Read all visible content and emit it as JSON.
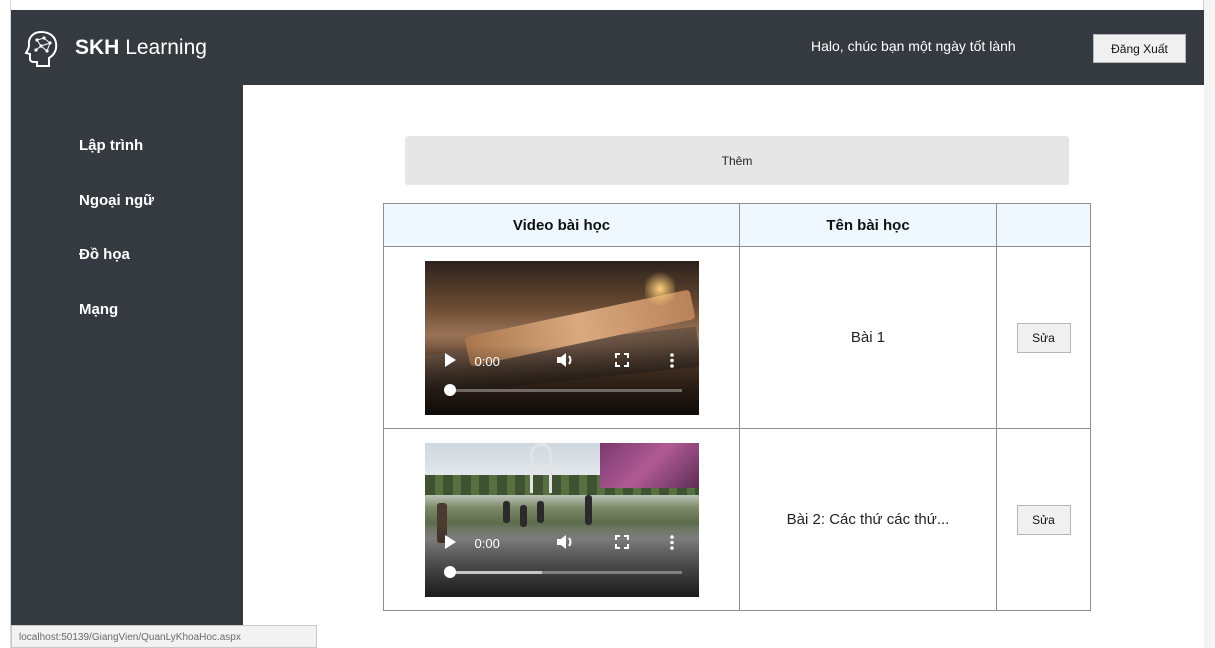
{
  "header": {
    "brand_bold": "SKH",
    "brand_rest": "Learning",
    "logo_icon": "brain-head-icon",
    "greeting": "Halo, chúc bạn một ngày tốt lành",
    "logout_label": "Đăng Xuất"
  },
  "sidebar": {
    "items": [
      {
        "label": "Lập trình"
      },
      {
        "label": "Ngoại ngữ"
      },
      {
        "label": "Đồ họa"
      },
      {
        "label": "Mạng"
      }
    ]
  },
  "main": {
    "add_label": "Thêm",
    "table": {
      "headers": [
        "Video bài học",
        "Tên bài học",
        ""
      ],
      "rows": [
        {
          "video_time": "0:00",
          "video_progress": 0.0,
          "buffered": 0.0,
          "name": "Bài 1",
          "edit_label": "Sửa"
        },
        {
          "video_time": "0:00",
          "video_progress": 0.0,
          "buffered": 0.4,
          "name": "Bài 2: Các thứ các thứ...",
          "edit_label": "Sửa"
        }
      ]
    }
  },
  "status_bar": {
    "url": "localhost:50139/GiangVien/QuanLyKhoaHoc.aspx"
  },
  "colors": {
    "dark_bg": "#343a40",
    "header_row_bg": "#f0f8ff",
    "add_button_bg": "#e6e6e6"
  }
}
